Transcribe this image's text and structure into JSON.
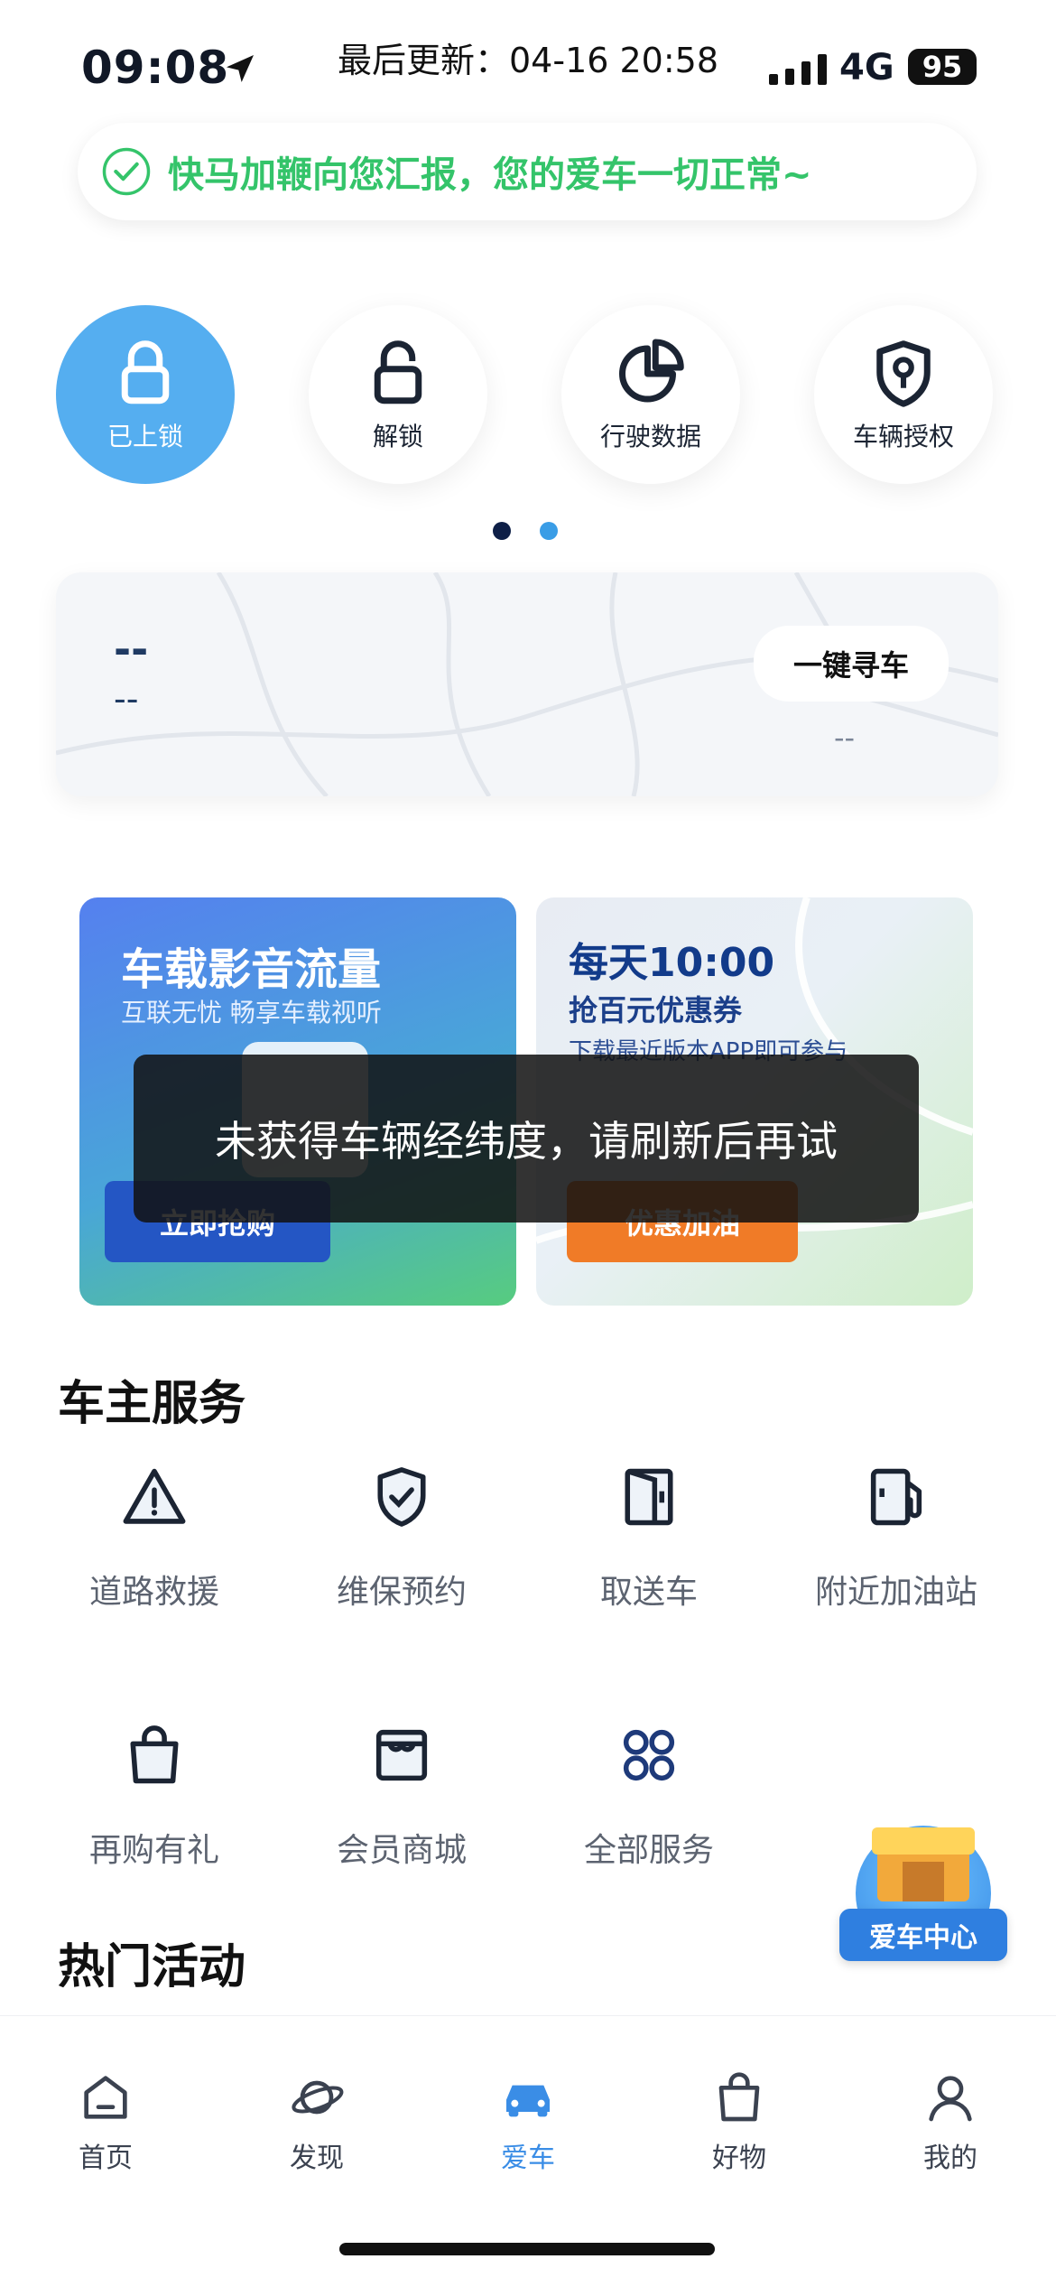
{
  "status_bar": {
    "time": "09:08",
    "update_text": "最后更新：04-16 20:58",
    "network": "4G",
    "battery": "95"
  },
  "banner": {
    "message": "快马加鞭向您汇报，您的爱车一切正常~",
    "icon": "check-circle-icon",
    "color": "#34c46a"
  },
  "quick_controls": [
    {
      "label": "已上锁",
      "icon": "lock-closed-icon"
    },
    {
      "label": "解锁",
      "icon": "lock-open-icon"
    },
    {
      "label": "行驶数据",
      "icon": "pie-chart-icon"
    },
    {
      "label": "车辆授权",
      "icon": "shield-key-icon"
    }
  ],
  "pager": {
    "count": 2,
    "active_index": 0
  },
  "find_car": {
    "line1": "--",
    "line2": "--",
    "button_label": "一键寻车",
    "distance": "--"
  },
  "promos": [
    {
      "title": "车载影音流量",
      "subtitle": "互联无忧 畅享车载视听",
      "button_label": "立即抢购"
    },
    {
      "title": "每天10:00",
      "subtitle": "抢百元优惠券",
      "note": "下载最近版本APP即可参与",
      "button_label": "优惠加油"
    }
  ],
  "toast": {
    "message": "未获得车辆经纬度，请刷新后再试"
  },
  "owner_services": {
    "title": "车主服务",
    "items": [
      {
        "label": "道路救援",
        "icon": "warning-triangle-icon"
      },
      {
        "label": "维保预约",
        "icon": "shield-check-icon"
      },
      {
        "label": "取送车",
        "icon": "door-icon"
      },
      {
        "label": "附近加油站",
        "icon": "fuel-pump-icon"
      },
      {
        "label": "再购有礼",
        "icon": "shopping-bag-icon"
      },
      {
        "label": "会员商城",
        "icon": "store-icon"
      },
      {
        "label": "全部服务",
        "icon": "command-icon"
      }
    ]
  },
  "hot_activities": {
    "title": "热门活动"
  },
  "floating_badge": {
    "label": "爱车中心"
  },
  "tab_bar": {
    "active_index": 2,
    "tabs": [
      {
        "label": "首页",
        "icon": "home-icon"
      },
      {
        "label": "发现",
        "icon": "planet-icon"
      },
      {
        "label": "爱车",
        "icon": "car-icon"
      },
      {
        "label": "好物",
        "icon": "bag-icon"
      },
      {
        "label": "我的",
        "icon": "user-icon"
      }
    ]
  },
  "colors": {
    "accent": "#3a8de6",
    "active_control": "#55aef0",
    "success": "#34c46a",
    "fuel_button": "#f07b27"
  }
}
